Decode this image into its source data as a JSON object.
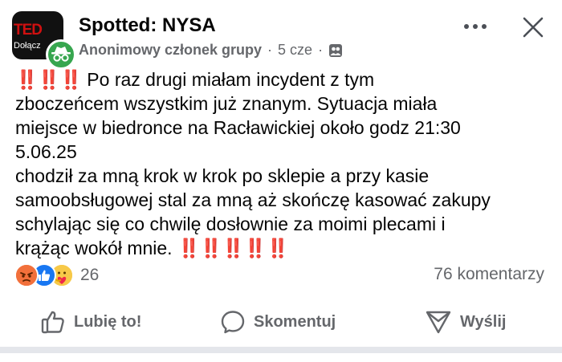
{
  "header": {
    "group_name": "Spotted: NYSA",
    "avatar_text_main": "TED",
    "avatar_text_sub": "Dołącz",
    "author": "Anonimowy członek grupy",
    "separator": "·",
    "time": "5 cze",
    "audience_icon": "group-audience-icon",
    "more_icon": "more-dots-icon",
    "close_icon": "close-icon"
  },
  "post": {
    "lines": [
      {
        "prefix": "‼️‼️‼️",
        "text": " Po raz drugi miałam incydent z tym"
      },
      {
        "text": "zboczeńcem wszystkim już znanym. Sytuacja miała"
      },
      {
        "text": "miejsce w biedronce na Racławickiej około godz 21:30"
      },
      {
        "text": "5.06.25"
      },
      {
        "text": "chodził za mną krok w krok po sklepie a przy kasie"
      },
      {
        "text": "samoobsługowej stal za mną aż skończę kasować  zakupy"
      },
      {
        "text": "schylając się co chwilę dosłownie za moimi plecami i"
      },
      {
        "text": "krążąc wokół mnie. ",
        "suffix": "‼️‼️‼️‼️‼️"
      }
    ]
  },
  "reactions": {
    "icons": [
      "angry-reaction-icon",
      "like-reaction-icon",
      "care-reaction-icon"
    ],
    "count": "26",
    "comments": "76 komentarzy"
  },
  "actions": {
    "like_label": "Lubię to!",
    "comment_label": "Skomentuj",
    "share_label": "Wyślij"
  },
  "colors": {
    "accent_blue": "#1877f2",
    "bang_red": "#e4212c",
    "secondary_text": "#65676b",
    "anon_badge_green": "#37a64f"
  }
}
